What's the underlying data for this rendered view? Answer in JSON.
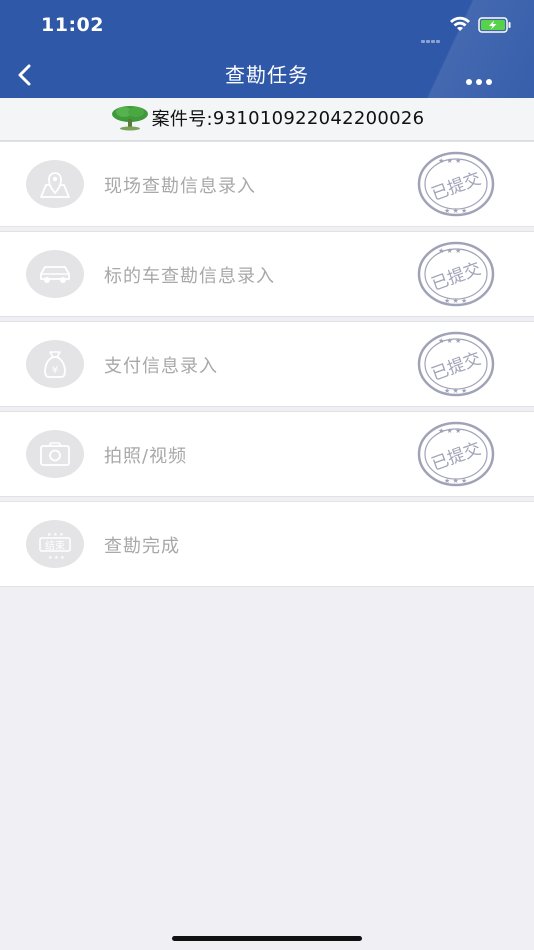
{
  "status_bar": {
    "time": "11:02"
  },
  "nav": {
    "title": "查勘任务"
  },
  "case": {
    "label": "案件号:",
    "number": "931010922042200026"
  },
  "items": [
    {
      "label": "现场查勘信息录入",
      "icon": "map-pin-icon",
      "stamp": "已提交"
    },
    {
      "label": "标的车查勘信息录入",
      "icon": "car-icon",
      "stamp": "已提交"
    },
    {
      "label": "支付信息录入",
      "icon": "money-bag-icon",
      "stamp": "已提交"
    },
    {
      "label": "拍照/视频",
      "icon": "camera-icon",
      "stamp": "已提交"
    },
    {
      "label": "查勘完成",
      "icon": "end-badge-icon",
      "icon_text": "结束"
    }
  ],
  "colors": {
    "header": "#2f58a8",
    "label": "#a8a8aa",
    "icon_bg": "#e4e4e6",
    "stamp": "#a0a3b8"
  }
}
